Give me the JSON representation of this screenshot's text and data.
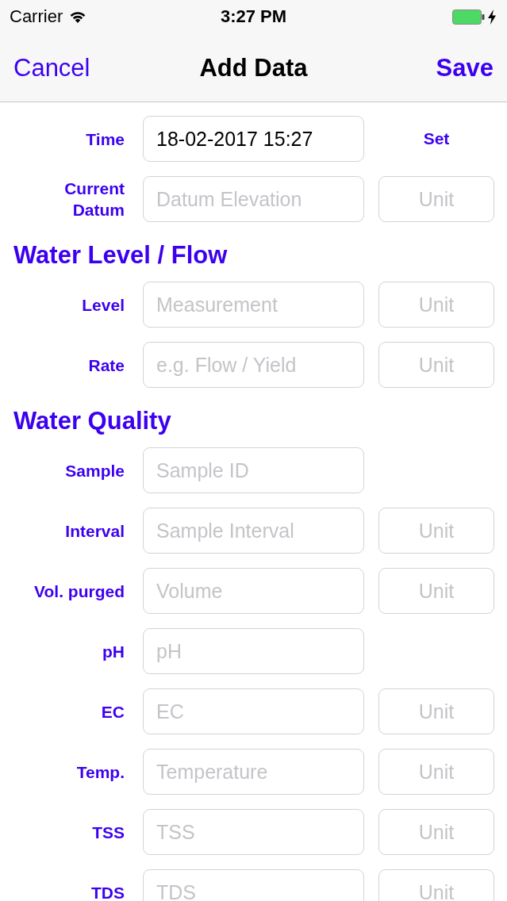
{
  "status_bar": {
    "carrier": "Carrier",
    "time": "3:27 PM"
  },
  "nav_bar": {
    "cancel": "Cancel",
    "title": "Add Data",
    "save": "Save"
  },
  "form": [
    {
      "kind": "field",
      "label": "Time",
      "value": "18-02-2017 15:27",
      "action": "Set"
    },
    {
      "kind": "field",
      "label": "Current Datum",
      "placeholder": "Datum Elevation",
      "unit_placeholder": "Unit"
    },
    {
      "kind": "heading",
      "text": "Water Level / Flow"
    },
    {
      "kind": "field",
      "label": "Level",
      "placeholder": "Measurement",
      "unit_placeholder": "Unit"
    },
    {
      "kind": "field",
      "label": "Rate",
      "placeholder": "e.g. Flow / Yield",
      "unit_placeholder": "Unit"
    },
    {
      "kind": "heading",
      "text": "Water Quality"
    },
    {
      "kind": "field",
      "label": "Sample",
      "placeholder": "Sample ID"
    },
    {
      "kind": "field",
      "label": "Interval",
      "placeholder": "Sample Interval",
      "unit_placeholder": "Unit"
    },
    {
      "kind": "field",
      "label": "Vol. purged",
      "placeholder": "Volume",
      "unit_placeholder": "Unit"
    },
    {
      "kind": "field",
      "label": "pH",
      "placeholder": "pH"
    },
    {
      "kind": "field",
      "label": "EC",
      "placeholder": "EC",
      "unit_placeholder": "Unit"
    },
    {
      "kind": "field",
      "label": "Temp.",
      "placeholder": "Temperature",
      "unit_placeholder": "Unit"
    },
    {
      "kind": "field",
      "label": "TSS",
      "placeholder": "TSS",
      "unit_placeholder": "Unit"
    },
    {
      "kind": "field",
      "label": "TDS",
      "placeholder": "TDS",
      "unit_placeholder": "Unit"
    }
  ]
}
